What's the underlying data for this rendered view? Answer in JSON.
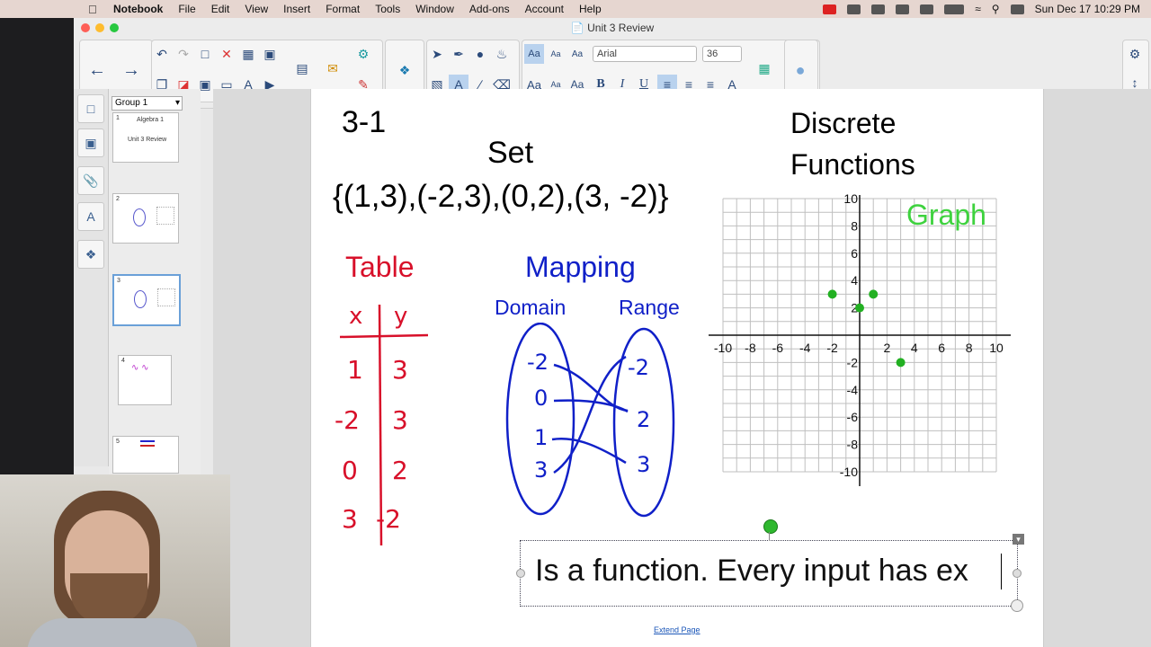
{
  "menubar": {
    "items": [
      "Notebook",
      "File",
      "Edit",
      "View",
      "Insert",
      "Format",
      "Tools",
      "Window",
      "Add-ons",
      "Account",
      "Help"
    ],
    "datetime": "Sun Dec 17  10:29 PM"
  },
  "window": {
    "title": "Unit 3 Review"
  },
  "toolbar": {
    "font_name": "Arial",
    "font_size": "36",
    "font_styles": [
      "B",
      "I",
      "U"
    ]
  },
  "sorter": {
    "group": "Group 1",
    "thumbs": [
      {
        "num": "1",
        "title": "Algebra 1",
        "subtitle": "Unit 3 Review"
      },
      {
        "num": "2"
      },
      {
        "num": "3"
      },
      {
        "num": "4"
      },
      {
        "num": "5"
      }
    ]
  },
  "slide": {
    "section": "3-1",
    "set_label": "Set",
    "set_value": "{(1,3),(-2,3),(0,2),(3, -2)}",
    "discrete_label_1": "Discrete",
    "discrete_label_2": "Functions",
    "table_label": "Table",
    "table_headers": [
      "x",
      "y"
    ],
    "table_rows": [
      [
        "1",
        "3"
      ],
      [
        "-2",
        "3"
      ],
      [
        "0",
        "2"
      ],
      [
        "3",
        "-2"
      ]
    ],
    "mapping_label": "Mapping",
    "domain_label": "Domain",
    "range_label": "Range",
    "domain_values": [
      "-2",
      "0",
      "1",
      "3"
    ],
    "range_values": [
      "-2",
      "2",
      "3"
    ],
    "graph_label": "Graph",
    "graph_points": [
      [
        1,
        3
      ],
      [
        -2,
        3
      ],
      [
        0,
        2
      ],
      [
        3,
        -2
      ]
    ],
    "graph_range": [
      -10,
      10
    ],
    "x_tick_labels": [
      "-10",
      "-8",
      "-6",
      "-4",
      "-2",
      "2",
      "4",
      "6",
      "8",
      "10"
    ],
    "y_tick_labels": [
      "10",
      "8",
      "6",
      "4",
      "2",
      "-2",
      "-4",
      "-6",
      "-8",
      "-10"
    ],
    "textbox": "Is a function. Every input has ex",
    "extend_page": "Extend Page"
  },
  "colors": {
    "red": "#d8102a",
    "blue": "#1020c8",
    "green": "#22b022"
  }
}
